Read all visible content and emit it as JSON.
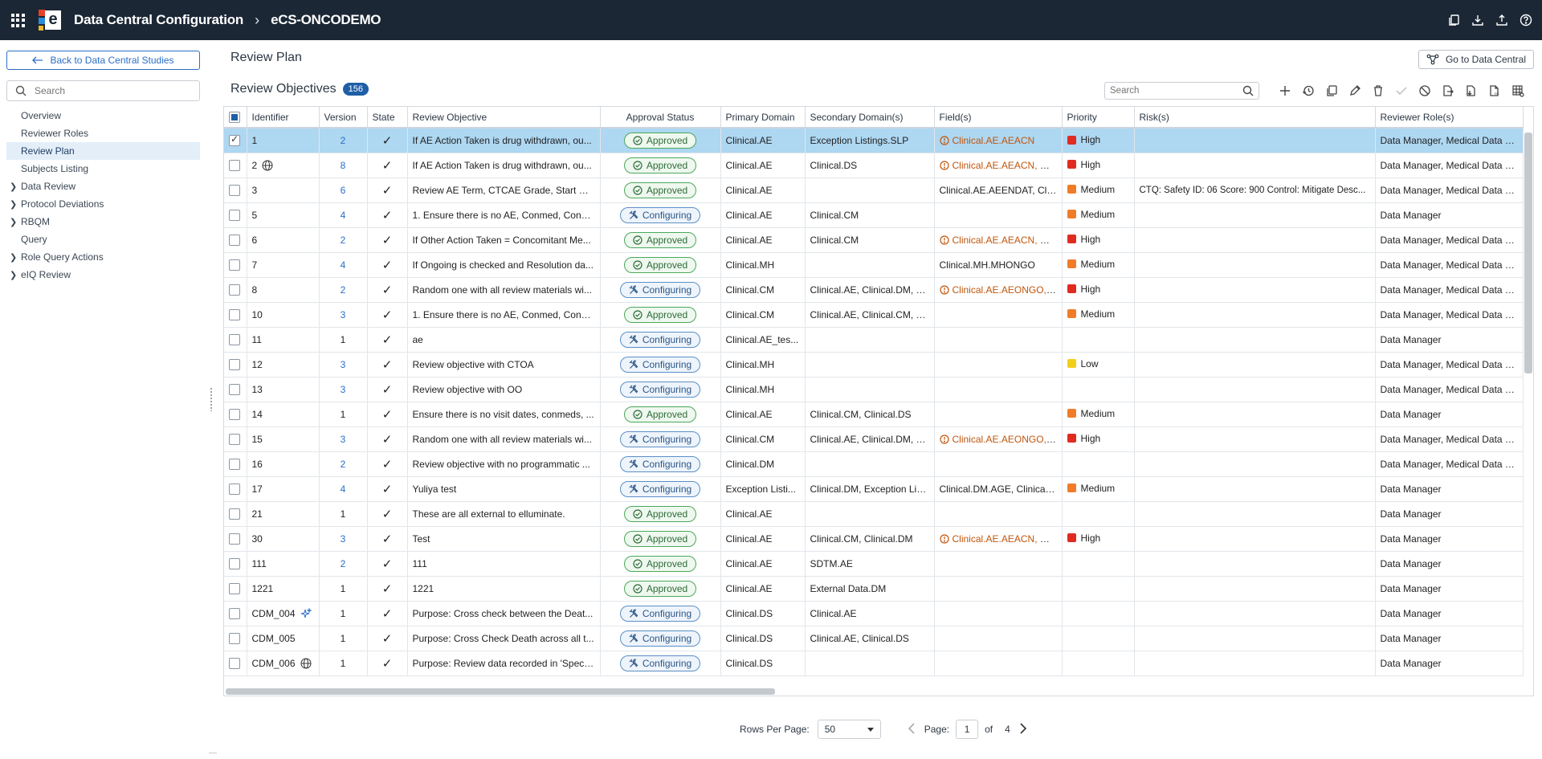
{
  "header": {
    "app_title": "Data Central Configuration",
    "separator": "›",
    "study": "eCS-ONCODEMO"
  },
  "leftnav": {
    "back_label": "Back to Data Central Studies",
    "search_placeholder": "Search",
    "items": [
      {
        "label": "Overview"
      },
      {
        "label": "Reviewer Roles"
      },
      {
        "label": "Review Plan"
      },
      {
        "label": "Subjects Listing"
      },
      {
        "label": "Data Review"
      },
      {
        "label": "Protocol Deviations"
      },
      {
        "label": "RBQM"
      },
      {
        "label": "Query"
      },
      {
        "label": "Role Query Actions"
      },
      {
        "label": "eIQ Review"
      }
    ]
  },
  "main": {
    "title": "Review Plan",
    "goto_label": "Go to Data Central",
    "objectives_title": "Review Objectives",
    "count": "156",
    "search_placeholder": "Search"
  },
  "table": {
    "columns": [
      "Identifier",
      "Version",
      "State",
      "Review Objective",
      "Approval Status",
      "Primary Domain",
      "Secondary Domain(s)",
      "Field(s)",
      "Priority",
      "Risk(s)",
      "Reviewer Role(s)"
    ],
    "state_mark": "✓",
    "rows": [
      {
        "id": "1",
        "version": "2",
        "objective": "If AE Action Taken is drug withdrawn, ou...",
        "status": "Approved",
        "primary": "Clinical.AE",
        "secondary": "Exception Listings.SLP",
        "fields": "Clinical.AE.AEACN",
        "priority": "High",
        "risk": "",
        "roles": "Data Manager, Medical Data Rev"
      },
      {
        "id": "2",
        "version": "8",
        "objective": "If AE Action Taken is drug withdrawn, ou...",
        "status": "Approved",
        "primary": "Clinical.AE",
        "secondary": "Clinical.DS",
        "fields": "Clinical.AE.AEACN, Cl...",
        "priority": "High",
        "risk": "",
        "roles": "Data Manager, Medical Data Rev"
      },
      {
        "id": "3",
        "version": "6",
        "objective": "Review AE Term, CTCAE Grade, Start Dat...",
        "status": "Approved",
        "primary": "Clinical.AE",
        "secondary": "",
        "fields": "Clinical.AE.AEENDAT, Clin...",
        "priority": "Medium",
        "risk": "CTQ: Safety ID: 06 Score: 900 Control: Mitigate Desc...",
        "roles": "Data Manager, Medical Data Rev"
      },
      {
        "id": "5",
        "version": "4",
        "objective": "1. Ensure there is no AE, Conmed, Conm...",
        "status": "Configuring",
        "primary": "Clinical.AE",
        "secondary": "Clinical.CM",
        "fields": "",
        "priority": "Medium",
        "risk": "",
        "roles": "Data Manager"
      },
      {
        "id": "6",
        "version": "2",
        "objective": "If Other Action Taken = Concomitant Me...",
        "status": "Approved",
        "primary": "Clinical.AE",
        "secondary": "Clinical.CM",
        "fields": "Clinical.AE.AEACN, Cl...",
        "priority": "High",
        "risk": "",
        "roles": "Data Manager, Medical Data Rev"
      },
      {
        "id": "7",
        "version": "4",
        "objective": "If Ongoing is checked and Resolution da...",
        "status": "Approved",
        "primary": "Clinical.MH",
        "secondary": "",
        "fields": "Clinical.MH.MHONGO",
        "priority": "Medium",
        "risk": "",
        "roles": "Data Manager, Medical Data Rev"
      },
      {
        "id": "8",
        "version": "2",
        "objective": "Random one with all review materials wi...",
        "status": "Configuring",
        "primary": "Clinical.CM",
        "secondary": "Clinical.AE, Clinical.DM, C...",
        "fields": "Clinical.AE.AEONGO, ...",
        "priority": "High",
        "risk": "",
        "roles": "Data Manager, Medical Data Rev"
      },
      {
        "id": "10",
        "version": "3",
        "objective": "1. Ensure there is no AE, Conmed, Conm...",
        "status": "Approved",
        "primary": "Clinical.CM",
        "secondary": "Clinical.AE, Clinical.CM, C...",
        "fields": "",
        "priority": "Medium",
        "risk": "",
        "roles": "Data Manager, Medical Data Rev"
      },
      {
        "id": "11",
        "version": "1",
        "objective": "ae",
        "status": "Configuring",
        "primary": "Clinical.AE_tes...",
        "secondary": "",
        "fields": "",
        "priority": "",
        "risk": "",
        "roles": "Data Manager"
      },
      {
        "id": "12",
        "version": "3",
        "objective": "Review objective with CTOA",
        "status": "Configuring",
        "primary": "Clinical.MH",
        "secondary": "",
        "fields": "",
        "priority": "Low",
        "risk": "",
        "roles": "Data Manager, Medical Data Rev"
      },
      {
        "id": "13",
        "version": "3",
        "objective": "Review objective with OO",
        "status": "Configuring",
        "primary": "Clinical.MH",
        "secondary": "",
        "fields": "",
        "priority": "",
        "risk": "",
        "roles": "Data Manager, Medical Data Rev"
      },
      {
        "id": "14",
        "version": "1",
        "objective": "Ensure there is no visit dates, conmeds, ...",
        "status": "Approved",
        "primary": "Clinical.AE",
        "secondary": "Clinical.CM, Clinical.DS",
        "fields": "",
        "priority": "Medium",
        "risk": "",
        "roles": "Data Manager"
      },
      {
        "id": "15",
        "version": "3",
        "objective": "Random one with all review materials wi...",
        "status": "Configuring",
        "primary": "Clinical.CM",
        "secondary": "Clinical.AE, Clinical.DM, C...",
        "fields": "Clinical.AE.AEONGO, ...",
        "priority": "High",
        "risk": "",
        "roles": "Data Manager, Medical Data Rev"
      },
      {
        "id": "16",
        "version": "2",
        "objective": "Review objective with no programmatic ...",
        "status": "Configuring",
        "primary": "Clinical.DM",
        "secondary": "",
        "fields": "",
        "priority": "",
        "risk": "",
        "roles": "Data Manager, Medical Data Rev"
      },
      {
        "id": "17",
        "version": "4",
        "objective": "Yuliya test",
        "status": "Configuring",
        "primary": "Exception Listi...",
        "secondary": "Clinical.DM, Exception Lis...",
        "fields": "Clinical.DM.AGE, Clinical....",
        "priority": "Medium",
        "risk": "",
        "roles": "Data Manager"
      },
      {
        "id": "21",
        "version": "1",
        "objective": "These are all external to elluminate.",
        "status": "Approved",
        "primary": "Clinical.AE",
        "secondary": "",
        "fields": "",
        "priority": "",
        "risk": "",
        "roles": "Data Manager"
      },
      {
        "id": "30",
        "version": "3",
        "objective": "Test",
        "status": "Approved",
        "primary": "Clinical.AE",
        "secondary": "Clinical.CM, Clinical.DM",
        "fields": "Clinical.AE.AEACN, Cl...",
        "priority": "High",
        "risk": "",
        "roles": "Data Manager"
      },
      {
        "id": "111",
        "version": "2",
        "objective": "111",
        "status": "Approved",
        "primary": "Clinical.AE",
        "secondary": "SDTM.AE",
        "fields": "",
        "priority": "",
        "risk": "",
        "roles": "Data Manager"
      },
      {
        "id": "1221",
        "version": "1",
        "objective": "1221",
        "status": "Approved",
        "primary": "Clinical.AE",
        "secondary": "External Data.DM",
        "fields": "",
        "priority": "",
        "risk": "",
        "roles": "Data Manager"
      },
      {
        "id": "CDM_004",
        "version": "1",
        "objective": "Purpose: Cross check between the Deat...",
        "status": "Configuring",
        "primary": "Clinical.DS",
        "secondary": "Clinical.AE",
        "fields": "",
        "priority": "",
        "risk": "",
        "roles": "Data Manager"
      },
      {
        "id": "CDM_005",
        "version": "1",
        "objective": "Purpose: Cross Check Death across all t...",
        "status": "Configuring",
        "primary": "Clinical.DS",
        "secondary": "Clinical.AE, Clinical.DS",
        "fields": "",
        "priority": "",
        "risk": "",
        "roles": "Data Manager"
      },
      {
        "id": "CDM_006",
        "version": "1",
        "objective": "Purpose: Review data recorded in 'Specif...",
        "status": "Configuring",
        "primary": "Clinical.DS",
        "secondary": "",
        "fields": "",
        "priority": "",
        "risk": "",
        "roles": "Data Manager"
      }
    ]
  },
  "pagination": {
    "rows_per_page_label": "Rows Per Page:",
    "rows_per_page": "50",
    "page_label": "Page:",
    "page": "1",
    "of_label": "of",
    "total_pages": "4"
  },
  "colors": {
    "high": "#e02b20",
    "medium": "#f07c2a",
    "low": "#f2cf1c",
    "header_bg": "#1b2735",
    "accent": "#2a6fc9"
  }
}
